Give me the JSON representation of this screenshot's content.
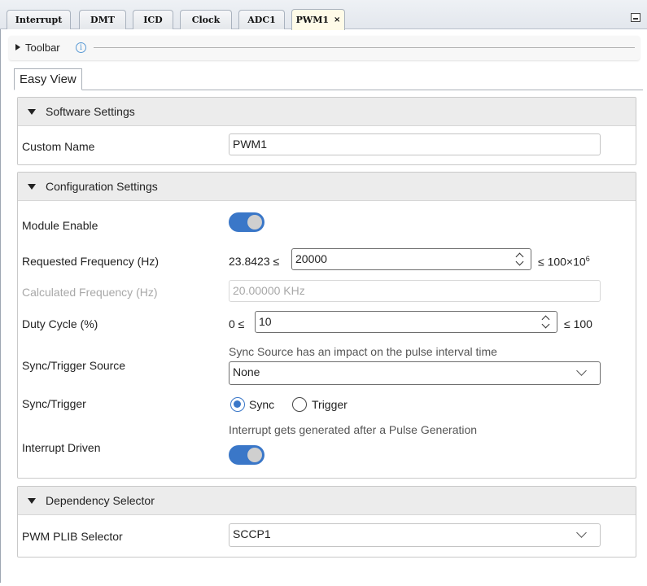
{
  "editor_tabs": [
    {
      "label": "Interrupt"
    },
    {
      "label": "DMT"
    },
    {
      "label": "ICD"
    },
    {
      "label": "Clock"
    },
    {
      "label": "ADC1"
    },
    {
      "label": "PWM1",
      "close": "×"
    }
  ],
  "toolbar": {
    "label": "Toolbar",
    "info": "i"
  },
  "view_tab": "Easy View",
  "software_settings": {
    "title": "Software Settings",
    "custom_name_label": "Custom Name",
    "custom_name_value": "PWM1"
  },
  "configuration_settings": {
    "title": "Configuration Settings",
    "module_enable_label": "Module Enable",
    "module_enable_on": true,
    "requested_frequency_label": "Requested Frequency (Hz)",
    "requested_frequency_min": "23.8423 ≤",
    "requested_frequency_value": "20000",
    "requested_frequency_max_base": "≤ 100×10",
    "requested_frequency_max_exp": "6",
    "calculated_frequency_label": "Calculated Frequency (Hz)",
    "calculated_frequency_value": "20.00000 KHz",
    "duty_cycle_label": "Duty Cycle (%)",
    "duty_cycle_min": "0 ≤",
    "duty_cycle_value": "10",
    "duty_cycle_max": "≤ 100",
    "sync_source_label": "Sync/Trigger Source",
    "sync_source_hint": "Sync Source has an impact on the pulse interval time",
    "sync_source_value": "None",
    "sync_trigger_label": "Sync/Trigger",
    "sync_option": "Sync",
    "trigger_option": "Trigger",
    "sync_selected": "Sync",
    "interrupt_hint": "Interrupt gets generated after a Pulse Generation",
    "interrupt_driven_label": "Interrupt Driven",
    "interrupt_driven_on": true
  },
  "dependency_selector": {
    "title": "Dependency Selector",
    "plib_label": "PWM PLIB Selector",
    "plib_value": "SCCP1"
  },
  "colors": {
    "accent": "#3a77c8",
    "active_tab": "#fffbe8",
    "group_header": "#ececec"
  }
}
